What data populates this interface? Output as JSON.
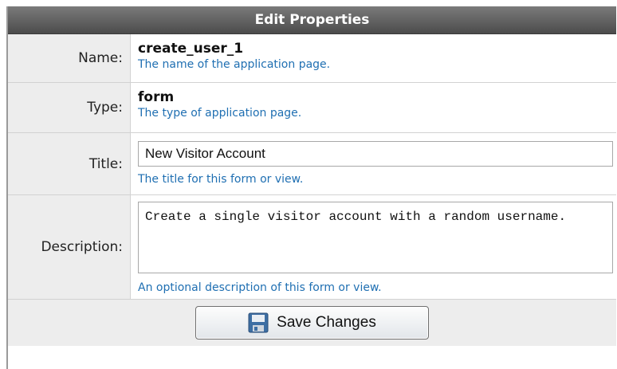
{
  "header": {
    "title": "Edit Properties"
  },
  "fields": {
    "name": {
      "label": "Name:",
      "value": "create_user_1",
      "hint": "The name of the application page."
    },
    "type": {
      "label": "Type:",
      "value": "form",
      "hint": "The type of application page."
    },
    "title": {
      "label": "Title:",
      "value": "New Visitor Account",
      "hint": "The title for this form or view."
    },
    "description": {
      "label": "Description:",
      "value": "Create a single visitor account with a random username.",
      "hint": "An optional description of this form or view."
    }
  },
  "actions": {
    "save_label": "Save Changes",
    "save_icon": "floppy-disk-icon"
  },
  "colors": {
    "header_bg": "#5a5a5a",
    "hint_text": "#1f6fb2",
    "label_bg": "#ededed"
  }
}
